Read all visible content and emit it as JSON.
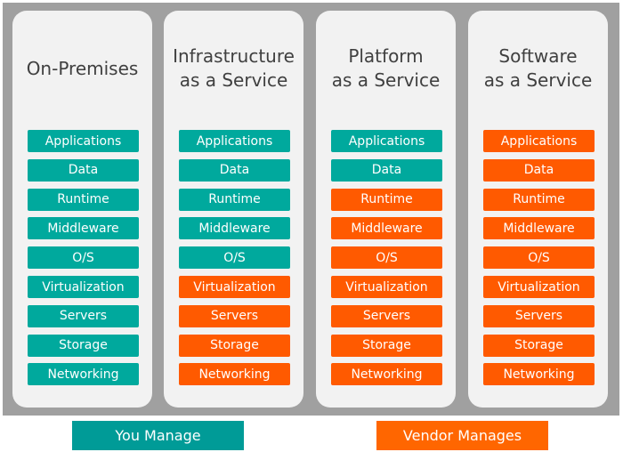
{
  "colors": {
    "you": "#00a99d",
    "vendor": "#ff5a00",
    "legend_you": "#009b97",
    "legend_vendor": "#ff6600"
  },
  "layers": [
    "Applications",
    "Data",
    "Runtime",
    "Middleware",
    "O/S",
    "Virtualization",
    "Servers",
    "Storage",
    "Networking"
  ],
  "columns": [
    {
      "title": [
        "On-Premises"
      ],
      "owners": [
        "you",
        "you",
        "you",
        "you",
        "you",
        "you",
        "you",
        "you",
        "you"
      ]
    },
    {
      "title": [
        "Infrastructure",
        "as a Service"
      ],
      "owners": [
        "you",
        "you",
        "you",
        "you",
        "you",
        "vendor",
        "vendor",
        "vendor",
        "vendor"
      ]
    },
    {
      "title": [
        "Platform",
        "as a Service"
      ],
      "owners": [
        "you",
        "you",
        "vendor",
        "vendor",
        "vendor",
        "vendor",
        "vendor",
        "vendor",
        "vendor"
      ]
    },
    {
      "title": [
        "Software",
        "as a Service"
      ],
      "owners": [
        "vendor",
        "vendor",
        "vendor",
        "vendor",
        "vendor",
        "vendor",
        "vendor",
        "vendor",
        "vendor"
      ]
    }
  ],
  "legend": {
    "you": "You Manage",
    "vendor": "Vendor Manages"
  }
}
